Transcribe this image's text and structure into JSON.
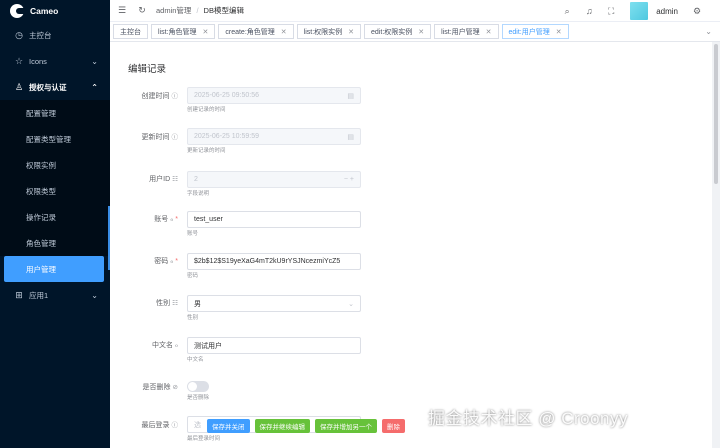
{
  "app": {
    "name": "Cameo"
  },
  "sidebar": {
    "items": [
      {
        "label": "主控台",
        "icon": "dashboard-icon"
      },
      {
        "label": "Icons",
        "icon": "star-icon"
      },
      {
        "label": "授权与认证",
        "icon": "user-icon",
        "open": true
      },
      {
        "label": "应用1",
        "icon": "grid-icon"
      }
    ],
    "subitems": [
      "配置管理",
      "配置类型管理",
      "权限实例",
      "权限类型",
      "操作记录",
      "角色管理",
      "用户管理"
    ],
    "active_subitem": "用户管理"
  },
  "header": {
    "breadcrumb": [
      "admin管理",
      "DB模型编辑"
    ],
    "user": "admin"
  },
  "tabs": [
    {
      "label": "主控台",
      "closable": false
    },
    {
      "label": "list:角色管理",
      "closable": true
    },
    {
      "label": "create:角色管理",
      "closable": true
    },
    {
      "label": "list:权限实例",
      "closable": true
    },
    {
      "label": "edit:权限实例",
      "closable": true
    },
    {
      "label": "list:用户管理",
      "closable": true
    },
    {
      "label": "edit:用户管理",
      "closable": true,
      "active": true
    }
  ],
  "form": {
    "title": "编辑记录",
    "fields": [
      {
        "label": "创建时间",
        "value": "2025-06-25 09:50:56",
        "help": "创建记录的时间",
        "disabled": true
      },
      {
        "label": "更新时间",
        "value": "2025-06-25 10:59:59",
        "help": "更新记录的时间",
        "disabled": true
      },
      {
        "label": "用户ID",
        "value": "2",
        "help": "字段说明",
        "disabled": true
      },
      {
        "label": "账号",
        "value": "test_user",
        "help": "账号",
        "required": true
      },
      {
        "label": "密码",
        "value": "$2b$12$S19yeXaG4mT2kU9rYSJNcezmiYcZ5",
        "help": "密码",
        "required": true
      },
      {
        "label": "性别",
        "value": "男",
        "help": "性别"
      },
      {
        "label": "中文名",
        "value": "测试用户",
        "help": "中文名"
      },
      {
        "label": "是否删除",
        "value": "",
        "help": "是否删除",
        "toggle": false
      },
      {
        "label": "最后登录",
        "value": "选",
        "help": "最后登录时间"
      }
    ]
  },
  "buttons": {
    "save_close": "保存并关闭",
    "save_continue": "保存并继续编辑",
    "save_add": "保存并增加另一个",
    "delete": "删除"
  },
  "watermark": "掘金技术社区 @ Croonyy",
  "colors": {
    "primary": "#409eff",
    "success": "#67c23a",
    "danger": "#f56c6c",
    "sidebar": "#001529"
  }
}
